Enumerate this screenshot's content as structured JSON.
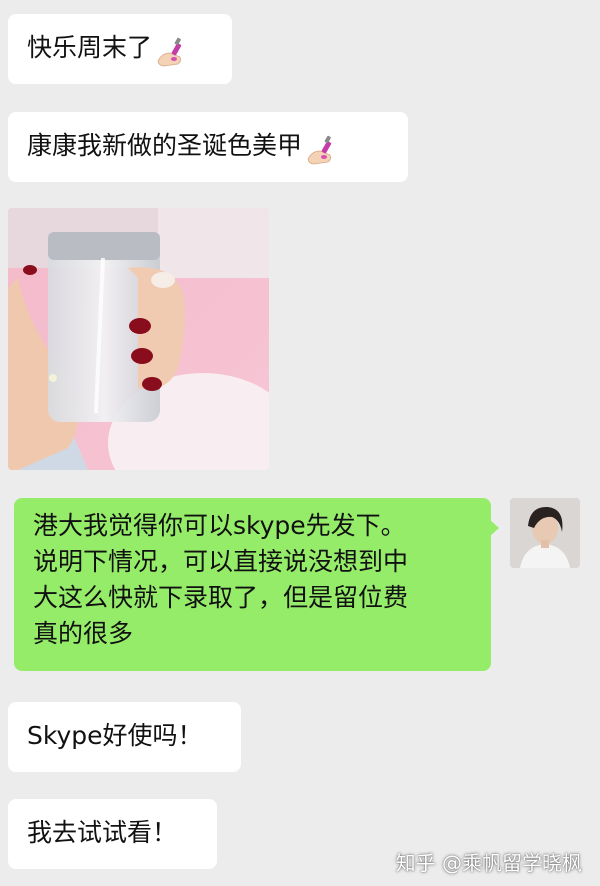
{
  "messages": {
    "m1": {
      "text": "快乐周末了",
      "emoji": "nail-polish-icon"
    },
    "m2": {
      "text": "康康我新做的圣诞色美甲",
      "emoji": "nail-polish-icon"
    },
    "m3": {
      "type": "photo",
      "content": "hand-holding-jar-photo"
    },
    "m4": {
      "lines": [
        "港大我觉得你可以skype先发下。",
        "说明下情况，可以直接说没想到中",
        "大这么快就下录取了，但是留位费",
        "真的很多"
      ]
    },
    "m5": {
      "text": "Skype好使吗！"
    },
    "m6": {
      "text": "我去试试看！"
    }
  },
  "watermark": {
    "text": "知乎 @乘帆留学晓枫"
  },
  "colors": {
    "background": "#ececec",
    "incoming_bubble": "#ffffff",
    "outgoing_bubble": "#95ec69"
  }
}
